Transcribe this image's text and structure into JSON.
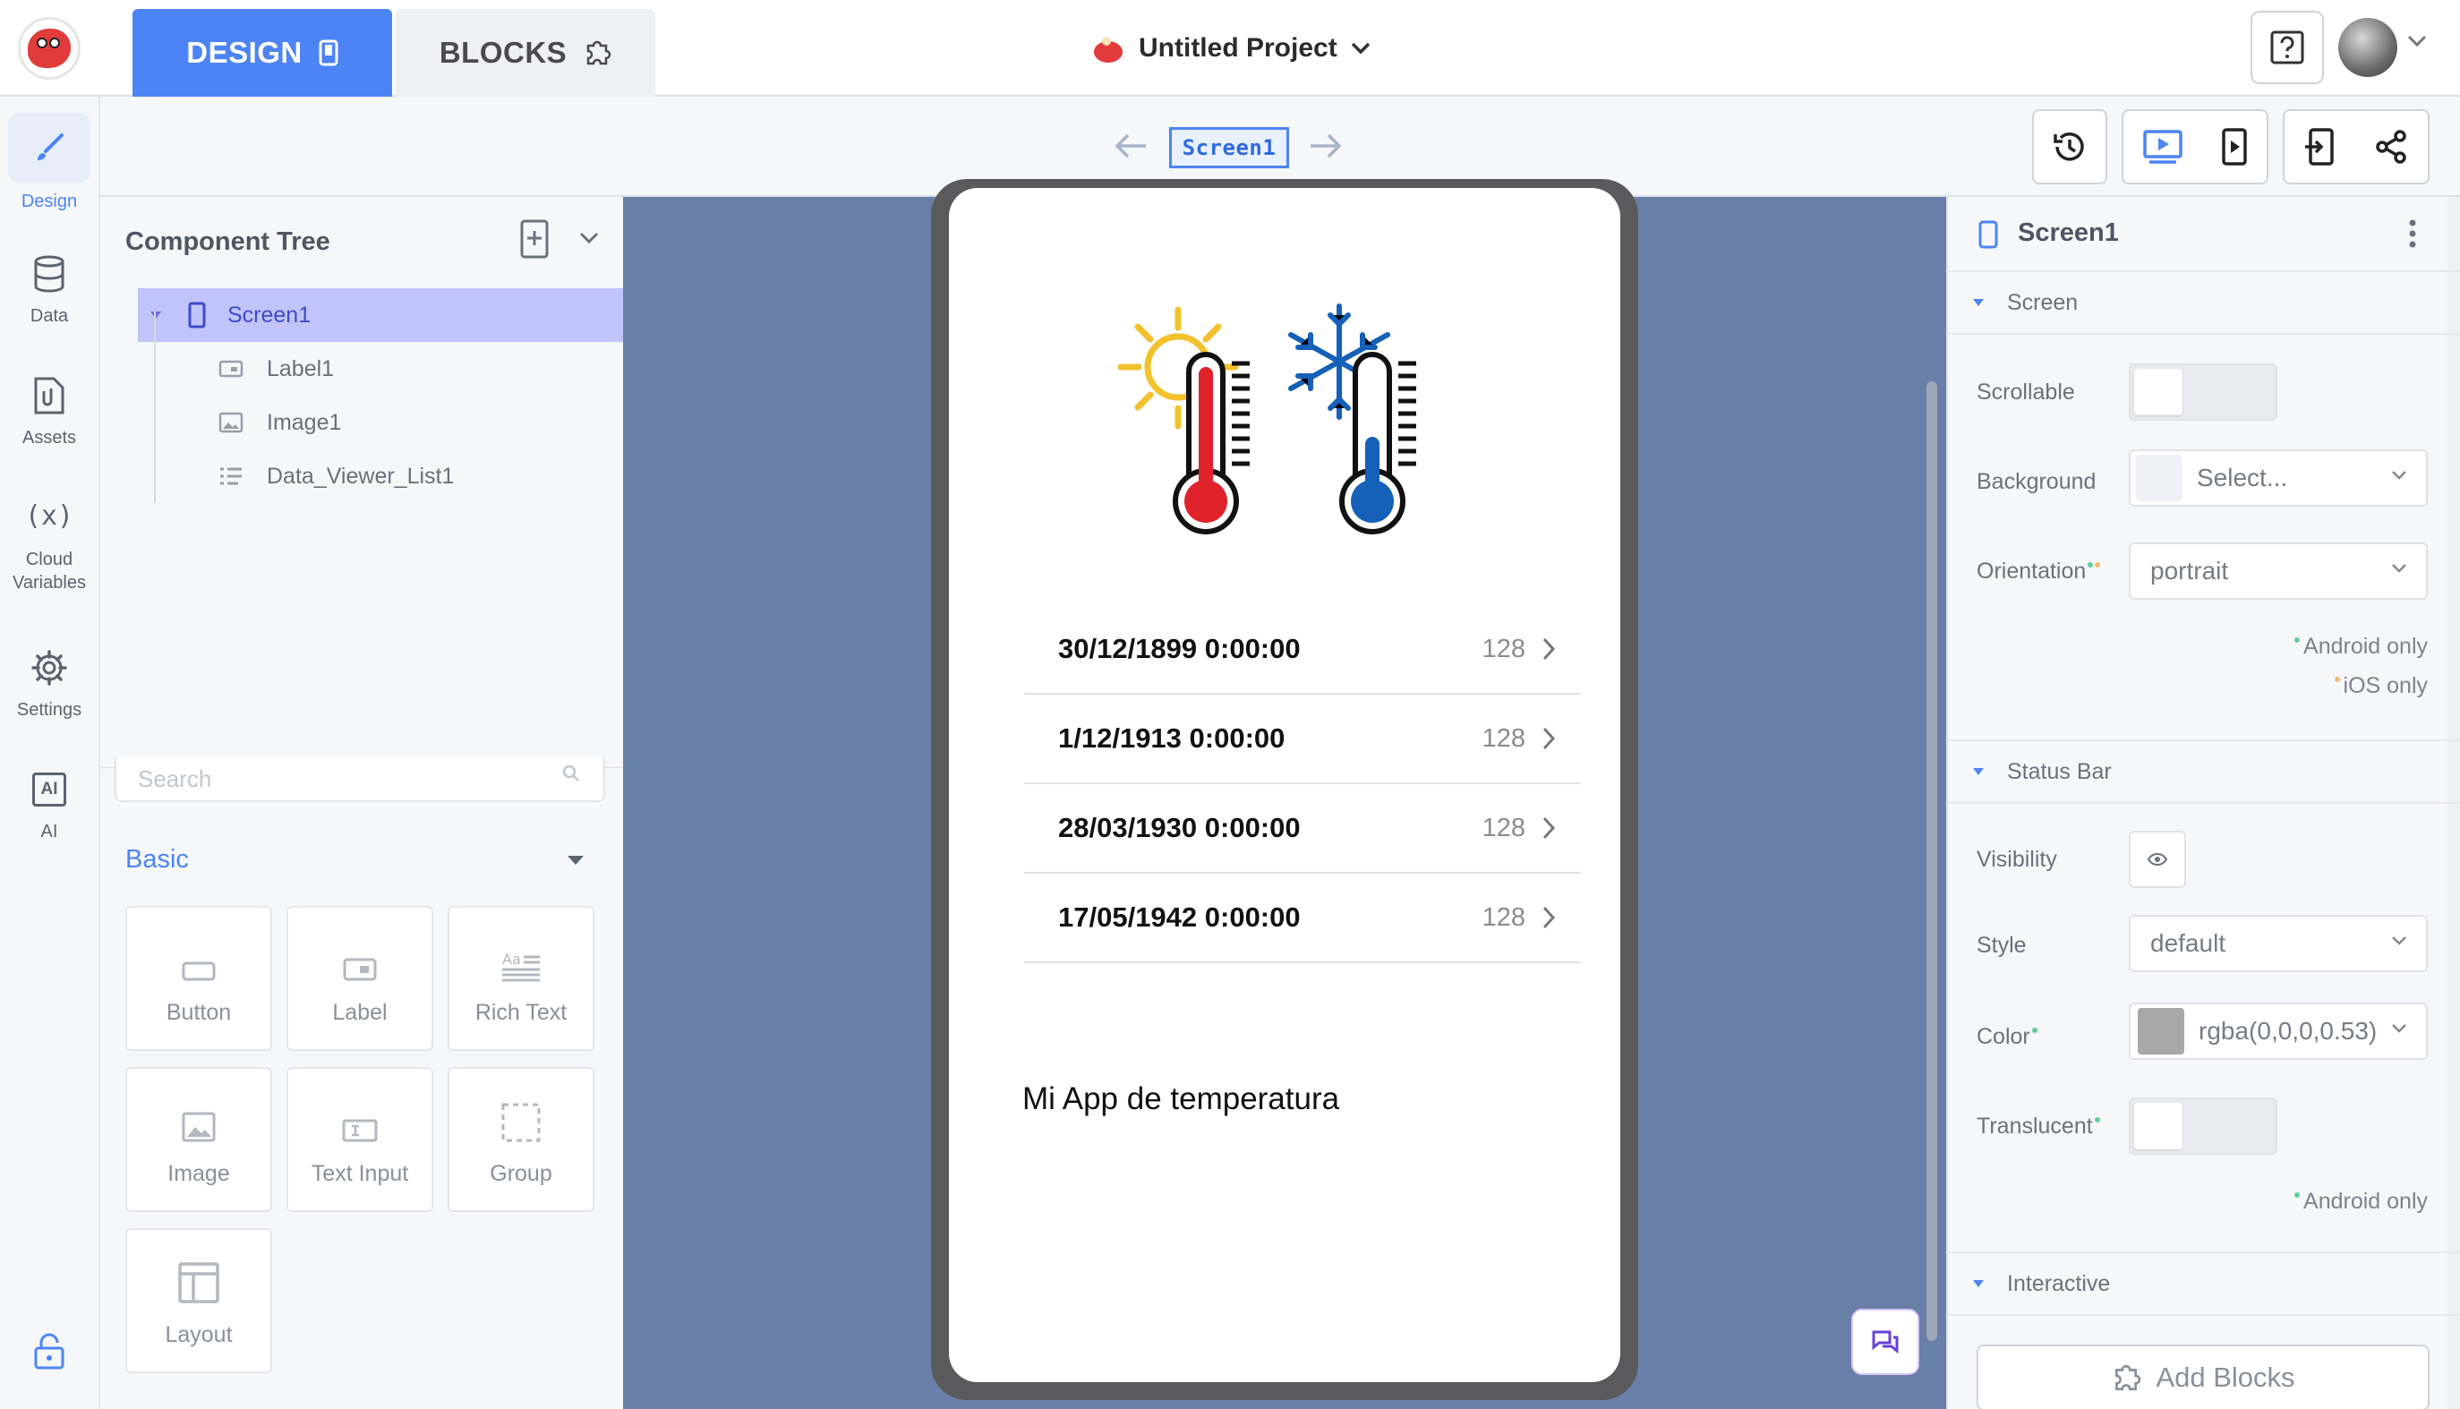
{
  "header": {
    "tabs": [
      {
        "label": "DESIGN",
        "active": true
      },
      {
        "label": "BLOCKS",
        "active": false
      }
    ],
    "project_name": "Untitled Project"
  },
  "rail": {
    "items": [
      {
        "label": "Design",
        "icon": "brush-icon",
        "active": true
      },
      {
        "label": "Data",
        "icon": "database-icon"
      },
      {
        "label": "Assets",
        "icon": "paperclip-file-icon"
      },
      {
        "label": "Cloud Variables",
        "icon": "variable-icon",
        "glyph": "(x)"
      },
      {
        "label": "Settings",
        "icon": "gear-icon"
      },
      {
        "label": "AI",
        "icon": "ai-icon",
        "glyph": "AI"
      }
    ]
  },
  "toolbar": {
    "current_screen": "Screen1"
  },
  "tree": {
    "title": "Component Tree",
    "items": [
      {
        "label": "Screen1",
        "icon": "phone-icon",
        "selected": true
      },
      {
        "label": "Label1",
        "icon": "label-icon"
      },
      {
        "label": "Image1",
        "icon": "image-icon"
      },
      {
        "label": "Data_Viewer_List1",
        "icon": "list-icon"
      }
    ]
  },
  "palette": {
    "search_placeholder": "Search",
    "category": "Basic",
    "tiles": [
      {
        "label": "Button"
      },
      {
        "label": "Label"
      },
      {
        "label": "Rich Text"
      },
      {
        "label": "Image"
      },
      {
        "label": "Text Input"
      },
      {
        "label": "Group"
      },
      {
        "label": "Layout"
      }
    ]
  },
  "preview": {
    "rows": [
      {
        "date": "30/12/1899 0:00:00",
        "count": "128"
      },
      {
        "date": "1/12/1913 0:00:00",
        "count": "128"
      },
      {
        "date": "28/03/1930 0:00:00",
        "count": "128"
      },
      {
        "date": "17/05/1942 0:00:00",
        "count": "128"
      }
    ],
    "label_text": "Mi App de temperatura"
  },
  "props": {
    "title": "Screen1",
    "sections": {
      "screen": "Screen",
      "status_bar": "Status Bar",
      "interactive": "Interactive"
    },
    "scrollable_label": "Scrollable",
    "background_label": "Background",
    "background_value": "Select...",
    "orientation_label": "Orientation",
    "orientation_value": "portrait",
    "android_only": "Android only",
    "ios_only": "iOS only",
    "visibility_label": "Visibility",
    "style_label": "Style",
    "style_value": "default",
    "color_label": "Color",
    "color_value": "rgba(0,0,0,0.53)",
    "translucent_label": "Translucent",
    "add_blocks": "Add Blocks"
  },
  "colors": {
    "accent": "#4d84f5",
    "selected_row": "#c0c4fb",
    "canvas_bg": "#6a7fa8",
    "android_dot": "#5fcf9a",
    "ios_dot": "#f5b971",
    "thermo_hot": "#e0232b",
    "thermo_cold": "#1560b8",
    "sun": "#f3c12c"
  }
}
